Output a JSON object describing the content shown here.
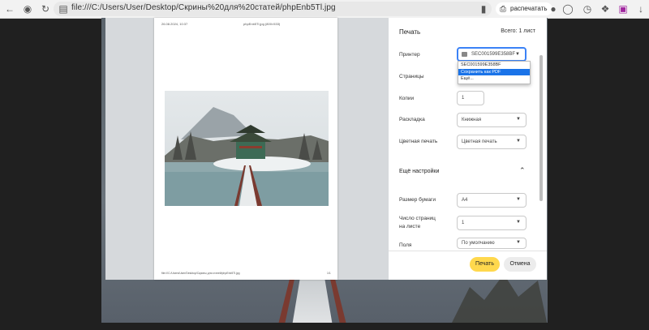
{
  "browser": {
    "url": "file:///C:/Users/User/Desktop/Скрины%20для%20статей/phpEnb5Tl.jpg",
    "print_label": "распечатать"
  },
  "preview": {
    "header_date": "26.08.2024, 10:37",
    "header_name": "phpEnb5Tl.jpg (800×533)",
    "footer_path": "file:///C:/Users/User/Desktop/Скрины для статей/phpEnb5Tl.jpg",
    "footer_page": "1/1"
  },
  "dialog": {
    "title": "Печать",
    "total": "Всего: 1 лист",
    "printer_label": "Принтер",
    "printer_value": "SEC001599E358BF",
    "pages_label": "Страницы",
    "copies_label": "Копии",
    "copies_value": "1",
    "layout_label": "Раскладка",
    "layout_value": "Книжная",
    "color_label": "Цветная печать",
    "color_value": "Цветная печать",
    "more_label": "Ещё настройки",
    "paper_label": "Размер бумаги",
    "paper_value": "A4",
    "pps_label_1": "Число страниц",
    "pps_label_2": "на листе",
    "pps_value": "1",
    "margins_label": "Поля",
    "margins_value": "По умолчанию",
    "print_button": "Печать",
    "cancel_button": "Отмена"
  },
  "dropdown": {
    "items": [
      "SEC001599E358BF",
      "Сохранить как PDF",
      "Ещё..."
    ]
  }
}
